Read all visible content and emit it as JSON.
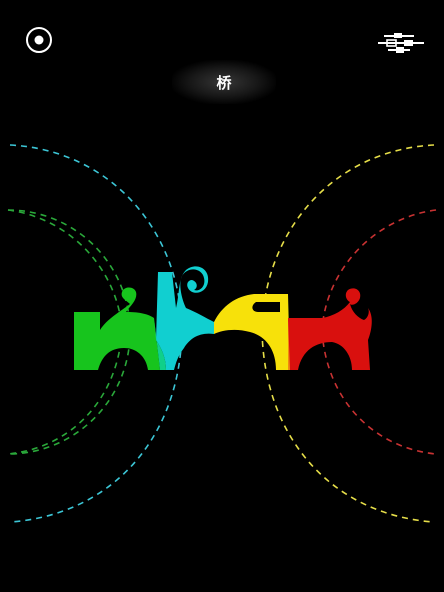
{
  "level": {
    "title": "桥"
  },
  "controls": {
    "record_icon": "record-icon",
    "menu_icon": "sliders-menu-icon"
  },
  "pieces": [
    {
      "name": "green-piece",
      "color": "#17c41d"
    },
    {
      "name": "cyan-piece",
      "color": "#11cfd0"
    },
    {
      "name": "yellow-piece",
      "color": "#f7e10a"
    },
    {
      "name": "red-piece",
      "color": "#d9100e"
    }
  ],
  "colors": {
    "background": "#000000",
    "green_arc": "#2aa83a",
    "cyan_arc": "#3cc6d6",
    "yellow_arc": "#e6de49",
    "red_arc": "#c83232",
    "text": "#ffffff"
  }
}
